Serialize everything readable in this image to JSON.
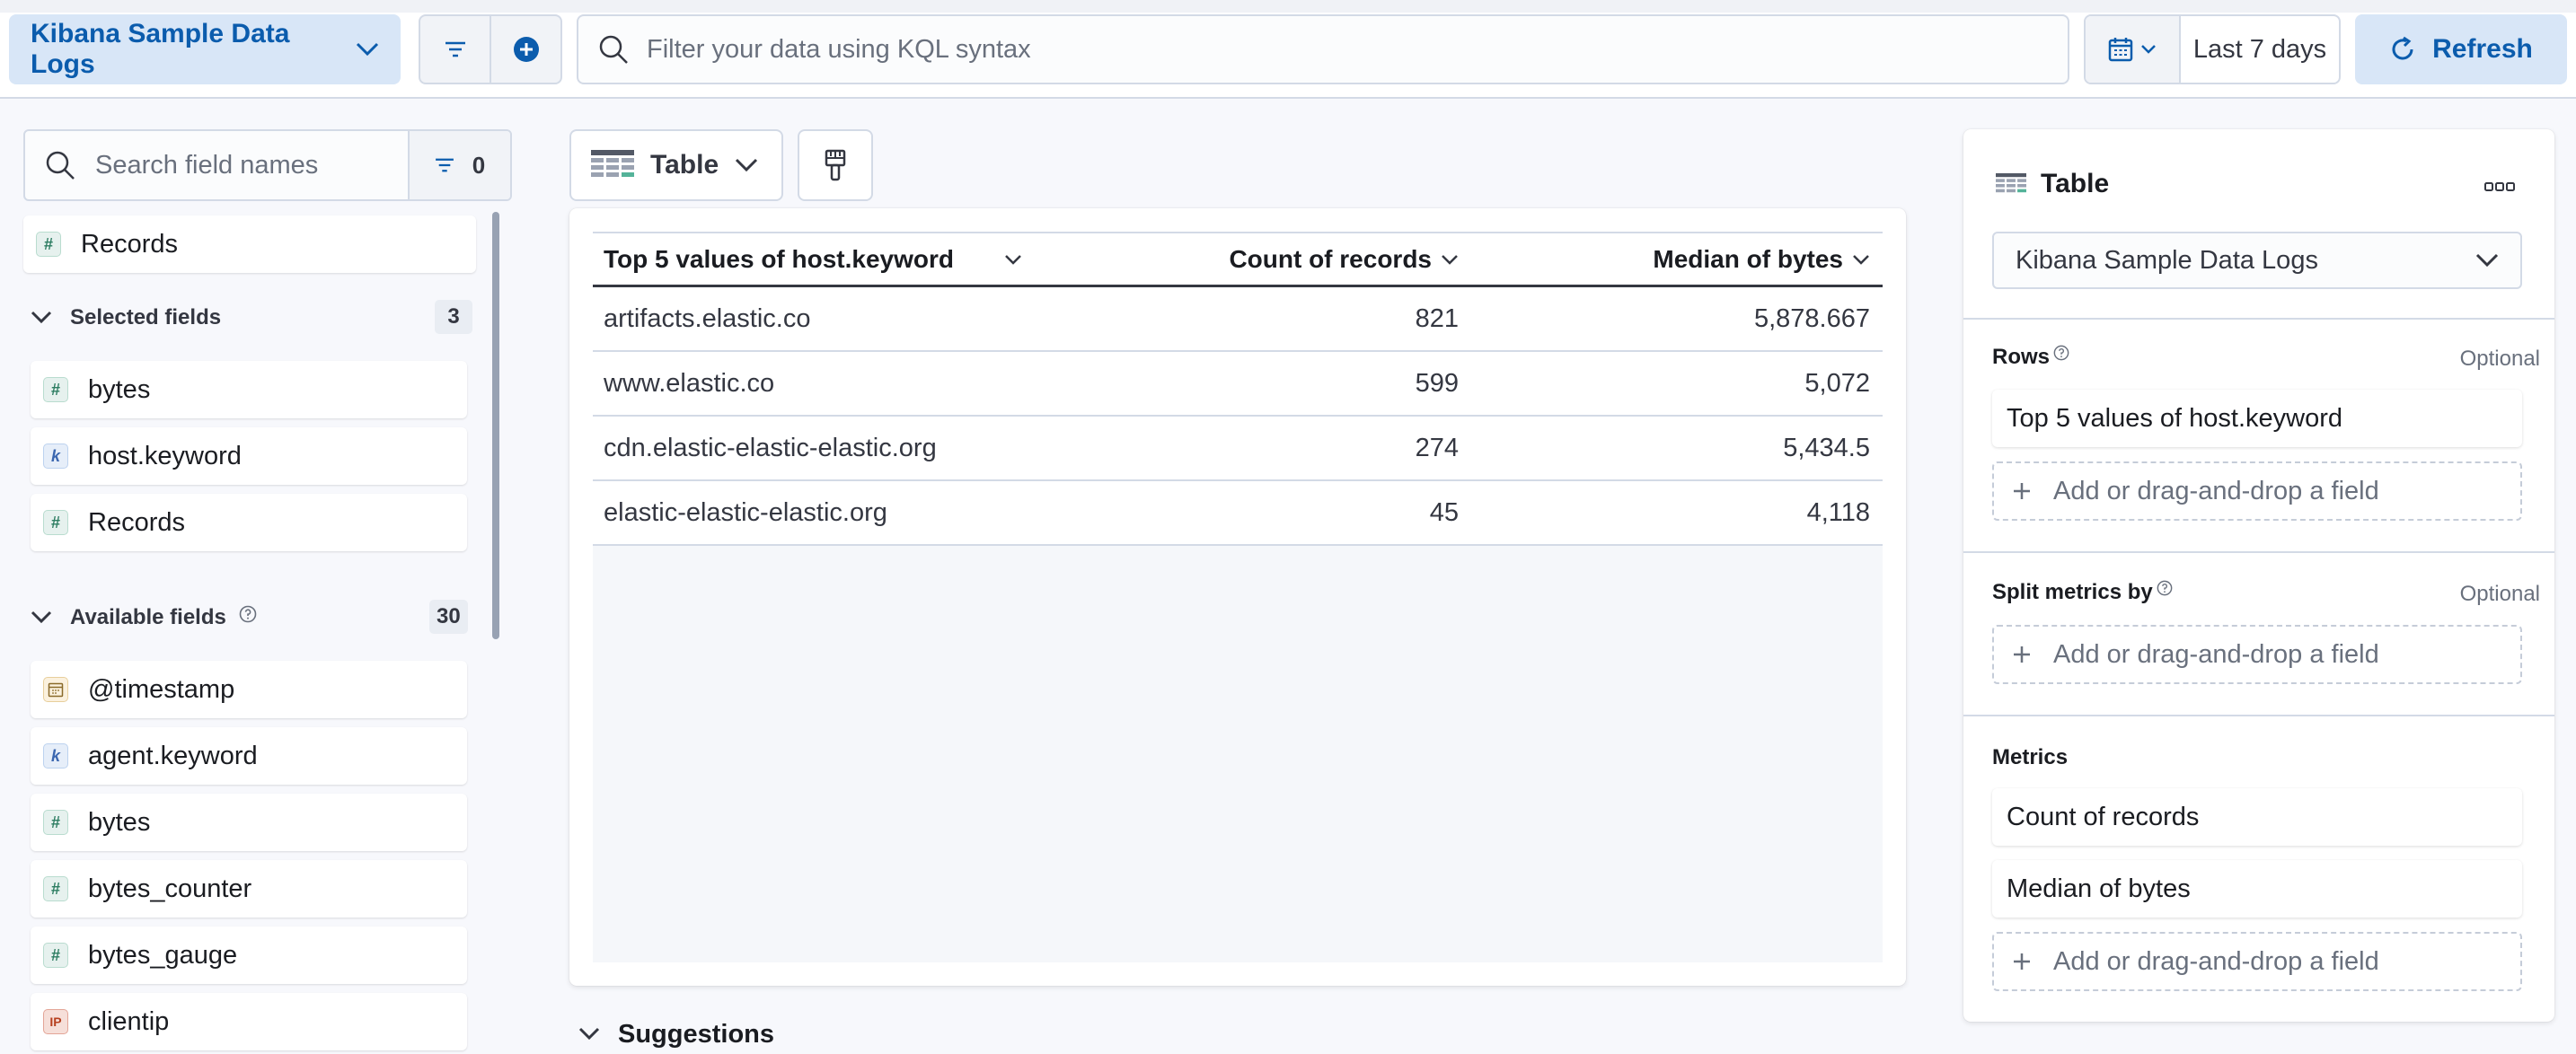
{
  "topbar": {
    "data_view": "Kibana Sample Data Logs",
    "query_placeholder": "Filter your data using KQL syntax",
    "date_range": "Last 7 days",
    "refresh_label": "Refresh"
  },
  "sidebar": {
    "search_placeholder": "Search field names",
    "filter_count": "0",
    "records_item": "Records",
    "selected": {
      "label": "Selected fields",
      "count": "3",
      "items": [
        "bytes",
        "host.keyword",
        "Records"
      ]
    },
    "available": {
      "label": "Available fields",
      "count": "30",
      "items": [
        "@timestamp",
        "agent.keyword",
        "bytes",
        "bytes_counter",
        "bytes_gauge",
        "clientip"
      ]
    }
  },
  "workspace": {
    "chart_type": "Table",
    "suggestions_label": "Suggestions",
    "table": {
      "headers": [
        "Top 5 values of host.keyword",
        "Count of records",
        "Median of bytes"
      ],
      "rows": [
        [
          "artifacts.elastic.co",
          "821",
          "5,878.667"
        ],
        [
          "www.elastic.co",
          "599",
          "5,072"
        ],
        [
          "cdn.elastic-elastic-elastic.org",
          "274",
          "5,434.5"
        ],
        [
          "elastic-elastic-elastic.org",
          "45",
          "4,118"
        ]
      ]
    }
  },
  "config": {
    "title": "Table",
    "layer_data_view": "Kibana Sample Data Logs",
    "rows": {
      "label": "Rows",
      "optional": "Optional",
      "item": "Top 5 values of host.keyword",
      "add": "Add or drag-and-drop a field"
    },
    "split": {
      "label": "Split metrics by",
      "optional": "Optional",
      "add": "Add or drag-and-drop a field"
    },
    "metrics": {
      "label": "Metrics",
      "items": [
        "Count of records",
        "Median of bytes"
      ],
      "add": "Add or drag-and-drop a field"
    }
  },
  "colors": {
    "accent": "#0b5cad",
    "accent_bg": "#d8e6f7",
    "border": "#d3dae6",
    "text": "#343741"
  },
  "icons": [
    "chevron-down-icon",
    "filter-icon",
    "plus-circle-icon",
    "search-icon",
    "calendar-icon",
    "refresh-icon",
    "table-icon",
    "brush-icon",
    "help-icon",
    "more-icon",
    "plus-icon"
  ]
}
